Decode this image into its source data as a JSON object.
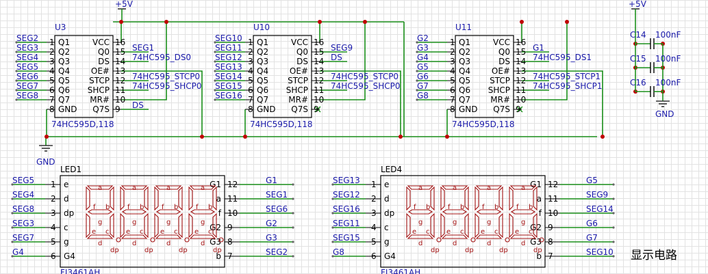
{
  "power": {
    "vcc": "+5V",
    "gnd": "GND"
  },
  "ic_pins_left": [
    "Q1",
    "Q2",
    "Q3",
    "Q4",
    "Q5",
    "Q6",
    "Q7",
    "GND"
  ],
  "ic_pins_left_nums": [
    "1",
    "2",
    "3",
    "4",
    "5",
    "6",
    "7",
    "8"
  ],
  "ic_pins_right": [
    "VCC",
    "Q0",
    "DS",
    "OE#",
    "STCP",
    "SHCP",
    "MR#",
    "Q7S"
  ],
  "ic_pins_right_nums": [
    "16",
    "15",
    "14",
    "13",
    "12",
    "11",
    "10",
    "9"
  ],
  "chips": [
    {
      "ref": "U3",
      "part": "74HC595D,118",
      "left_nets": [
        "SEG2",
        "SEG3",
        "SEG4",
        "SEG5",
        "SEG6",
        "SEG7",
        "SEG8"
      ],
      "right_nets": [
        "SEG1",
        "74HC595_DS0",
        "",
        "74HC595_STCP0",
        "74HC595_SHCP0",
        "",
        "DS"
      ]
    },
    {
      "ref": "U10",
      "part": "74HC595D,118",
      "left_nets": [
        "SEG10",
        "SEG11",
        "SEG12",
        "SEG13",
        "SEG14",
        "SEG15",
        "SEG16"
      ],
      "right_nets": [
        "SEG9",
        "DS",
        "",
        "74HC595_STCP0",
        "74HC595_SHCP0",
        "",
        ""
      ]
    },
    {
      "ref": "U11",
      "part": "74HC595D,118",
      "left_nets": [
        "G2",
        "G3",
        "G4",
        "G5",
        "G6",
        "G7",
        "G8"
      ],
      "right_nets": [
        "G1",
        "74HC595_DS1",
        "",
        "74HC595_STCP1",
        "74HC595_SHCP1",
        "",
        ""
      ]
    }
  ],
  "caps": [
    {
      "ref": "C14",
      "value": "100nF"
    },
    {
      "ref": "C15",
      "value": "100nF"
    },
    {
      "ref": "C16",
      "value": "100nF"
    }
  ],
  "displays": [
    {
      "ref": "LED1",
      "part": "FJ3461AH",
      "left_pins": [
        {
          "net": "SEG5",
          "num": "1",
          "name": "e"
        },
        {
          "net": "SEG4",
          "num": "2",
          "name": "d"
        },
        {
          "net": "SEG8",
          "num": "3",
          "name": "dp"
        },
        {
          "net": "SEG3",
          "num": "4",
          "name": "c"
        },
        {
          "net": "SEG7",
          "num": "5",
          "name": "g"
        },
        {
          "net": "G4",
          "num": "6",
          "name": "G4"
        }
      ],
      "right_pins": [
        {
          "net": "G1",
          "num": "12",
          "name": "G1"
        },
        {
          "net": "SEG1",
          "num": "11",
          "name": "a"
        },
        {
          "net": "SEG6",
          "num": "10",
          "name": "f"
        },
        {
          "net": "G2",
          "num": "9",
          "name": "G2"
        },
        {
          "net": "G3",
          "num": "8",
          "name": "G3"
        },
        {
          "net": "SEG2",
          "num": "7",
          "name": "b"
        }
      ]
    },
    {
      "ref": "LED4",
      "part": "FJ3461AH",
      "left_pins": [
        {
          "net": "SEG13",
          "num": "1",
          "name": "e"
        },
        {
          "net": "SEG12",
          "num": "2",
          "name": "d"
        },
        {
          "net": "SEG16",
          "num": "3",
          "name": "dp"
        },
        {
          "net": "SEG11",
          "num": "4",
          "name": "c"
        },
        {
          "net": "SEG15",
          "num": "5",
          "name": "g"
        },
        {
          "net": "G8",
          "num": "6",
          "name": "G4"
        }
      ],
      "right_pins": [
        {
          "net": "G5",
          "num": "12",
          "name": "G1"
        },
        {
          "net": "SEG9",
          "num": "11",
          "name": "a"
        },
        {
          "net": "SEG14",
          "num": "10",
          "name": "f"
        },
        {
          "net": "G6",
          "num": "9",
          "name": "G2"
        },
        {
          "net": "G7",
          "num": "8",
          "name": "G3"
        },
        {
          "net": "SEG10",
          "num": "7",
          "name": "b"
        }
      ]
    }
  ],
  "segment_letters": {
    "a": "a",
    "b": "b",
    "c": "c",
    "d": "d",
    "e": "e",
    "f": "f",
    "g": "g",
    "dp": "dp"
  },
  "caption": "显示电路",
  "colors": {
    "wire": "#1a8f1a",
    "net_label": "#1a1aaa",
    "component": "#a01010",
    "junction": "#c00000",
    "body": "#000000"
  }
}
